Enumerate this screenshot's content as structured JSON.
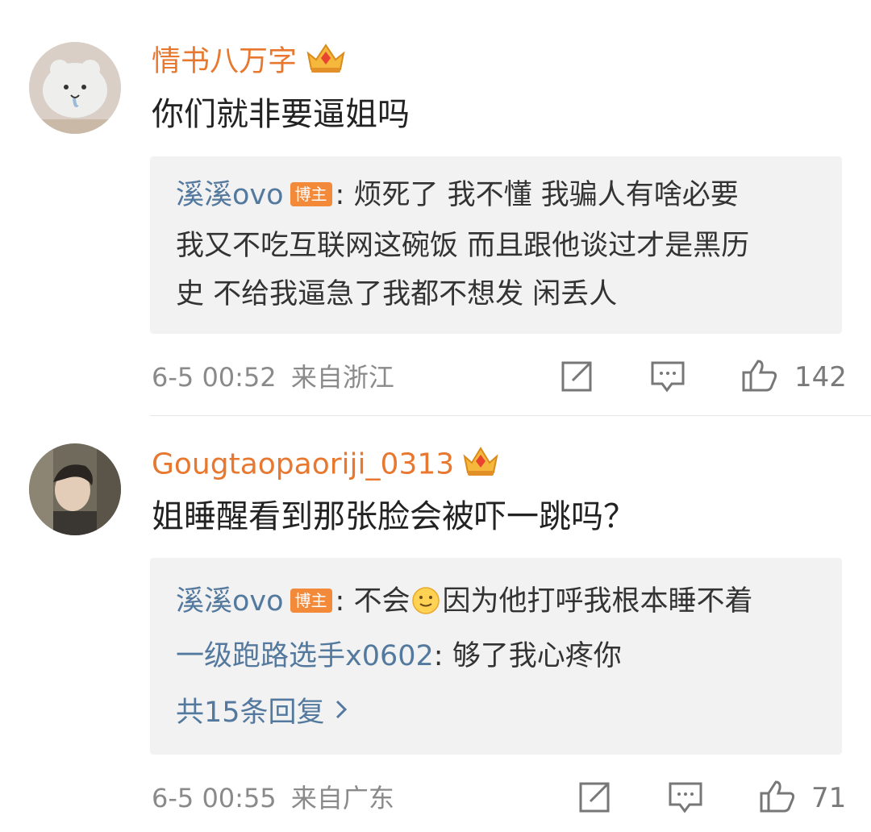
{
  "comments": [
    {
      "username": "情书八万字",
      "text": "你们就非要逼姐吗",
      "replies": [
        {
          "author": "溪溪ovo",
          "badge": "博主",
          "lines": [
            ": 烦死了 我不懂 我骗人有啥必要",
            "我又不吃互联网这碗饭 而且跟他谈过才是黑历",
            "史 不给我逼急了我都不想发 闲丢人"
          ]
        }
      ],
      "time": "6-5 00:52",
      "location": "来自浙江",
      "likes": "142"
    },
    {
      "username": "Gougtaopaoriji_0313",
      "text": "姐睡醒看到那张脸会被吓一跳吗？",
      "replies": [
        {
          "author": "溪溪ovo",
          "badge": "博主",
          "text_before_emoji": ": 不会",
          "text_after_emoji": "因为他打呼我根本睡不着"
        },
        {
          "author": "一级跑路选手x0602",
          "text": ": 够了我心疼你"
        }
      ],
      "more_replies": "共15条回复",
      "time": "6-5 00:55",
      "location": "来自广东",
      "likes": "71"
    }
  ],
  "colors": {
    "username": "#e8782f",
    "reply_name": "#53799e",
    "badge": "#f38a39",
    "reply_bg": "#f2f2f2"
  },
  "icons": [
    "crown-icon",
    "share-icon",
    "comment-icon",
    "like-icon",
    "smile-emoji-icon",
    "chevron-right-icon"
  ]
}
